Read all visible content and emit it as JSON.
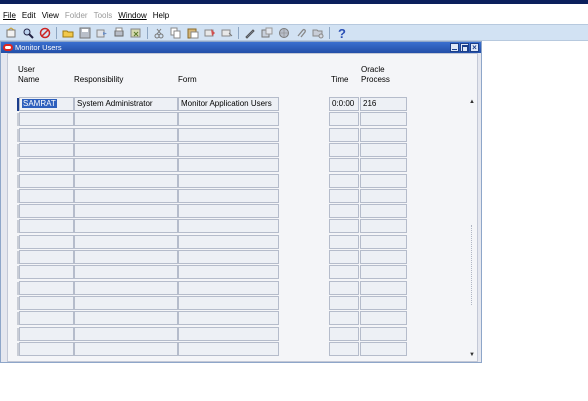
{
  "menu": {
    "file": "File",
    "edit": "Edit",
    "view": "View",
    "folder": "Folder",
    "tools": "Tools",
    "window": "Window",
    "help": "Help"
  },
  "window": {
    "title": "Monitor Users"
  },
  "table": {
    "headers": {
      "user_name_line1": "User",
      "user_name_line2": "Name",
      "responsibility": "Responsibility",
      "form": "Form",
      "time": "Time",
      "oracle_process_line1": "Oracle",
      "oracle_process_line2": "Process"
    },
    "rows": [
      {
        "user_name": "SAMRAT",
        "responsibility": "System Administrator",
        "form": "Monitor Application Users",
        "time": "0:0:00",
        "oracle_process": "216"
      },
      {
        "user_name": "",
        "responsibility": "",
        "form": "",
        "time": "",
        "oracle_process": ""
      },
      {
        "user_name": "",
        "responsibility": "",
        "form": "",
        "time": "",
        "oracle_process": ""
      },
      {
        "user_name": "",
        "responsibility": "",
        "form": "",
        "time": "",
        "oracle_process": ""
      },
      {
        "user_name": "",
        "responsibility": "",
        "form": "",
        "time": "",
        "oracle_process": ""
      },
      {
        "user_name": "",
        "responsibility": "",
        "form": "",
        "time": "",
        "oracle_process": ""
      },
      {
        "user_name": "",
        "responsibility": "",
        "form": "",
        "time": "",
        "oracle_process": ""
      },
      {
        "user_name": "",
        "responsibility": "",
        "form": "",
        "time": "",
        "oracle_process": ""
      },
      {
        "user_name": "",
        "responsibility": "",
        "form": "",
        "time": "",
        "oracle_process": ""
      },
      {
        "user_name": "",
        "responsibility": "",
        "form": "",
        "time": "",
        "oracle_process": ""
      },
      {
        "user_name": "",
        "responsibility": "",
        "form": "",
        "time": "",
        "oracle_process": ""
      },
      {
        "user_name": "",
        "responsibility": "",
        "form": "",
        "time": "",
        "oracle_process": ""
      },
      {
        "user_name": "",
        "responsibility": "",
        "form": "",
        "time": "",
        "oracle_process": ""
      },
      {
        "user_name": "",
        "responsibility": "",
        "form": "",
        "time": "",
        "oracle_process": ""
      },
      {
        "user_name": "",
        "responsibility": "",
        "form": "",
        "time": "",
        "oracle_process": ""
      },
      {
        "user_name": "",
        "responsibility": "",
        "form": "",
        "time": "",
        "oracle_process": ""
      },
      {
        "user_name": "",
        "responsibility": "",
        "form": "",
        "time": "",
        "oracle_process": ""
      }
    ]
  },
  "toolbar_icons": [
    "new-icon",
    "find-icon",
    "cancel-icon",
    "open-folder-icon",
    "save-icon",
    "next-step-icon",
    "print-icon",
    "close-form-icon",
    "cut-icon",
    "copy-icon",
    "paste-icon",
    "clear-record-icon",
    "delete-record-icon",
    "edit-field-icon",
    "zoom-icon",
    "translations-icon",
    "attachments-icon",
    "folder-tools-icon",
    "help-icon"
  ],
  "colors": {
    "title_bar": "#224ea8",
    "selection": "#2d5fbd",
    "toolbar": "#d2e2f3"
  }
}
